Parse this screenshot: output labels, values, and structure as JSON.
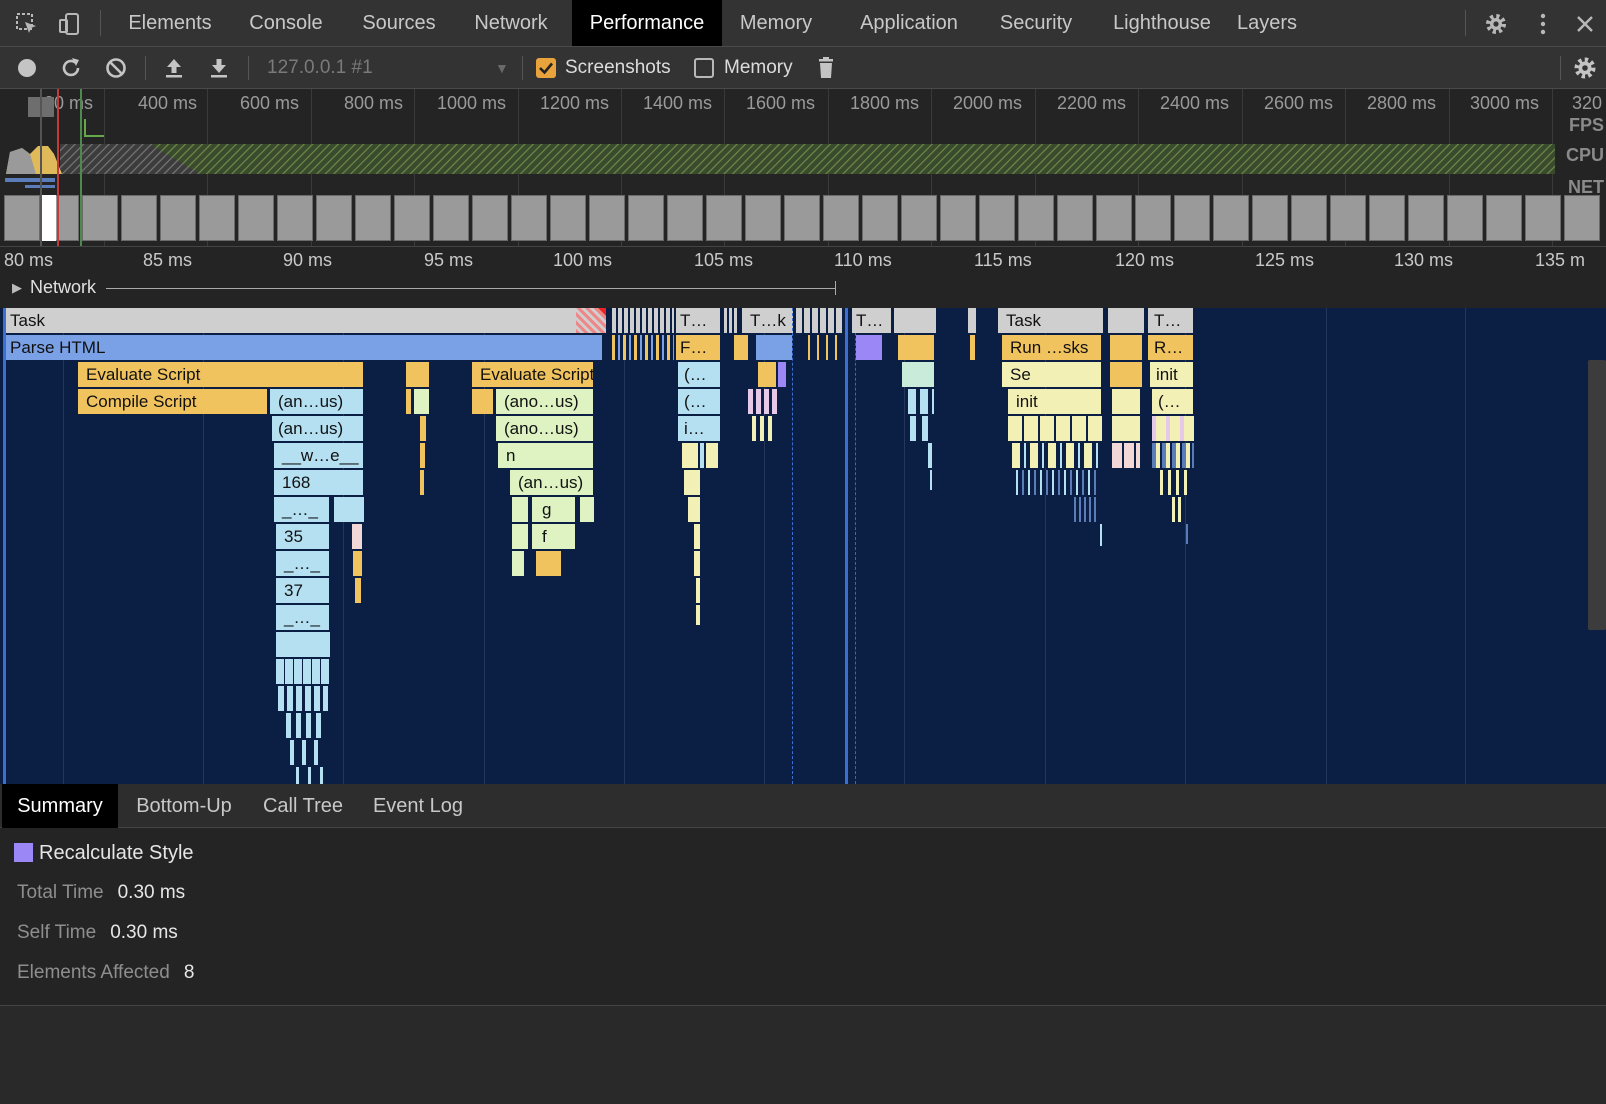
{
  "tabs": [
    "Elements",
    "Console",
    "Sources",
    "Network",
    "Performance",
    "Memory",
    "Application",
    "Security",
    "Lighthouse",
    "Layers"
  ],
  "active_tab": "Performance",
  "toolbar": {
    "target": "127.0.0.1 #1",
    "screenshots_label": "Screenshots",
    "screenshots_checked": true,
    "memory_label": "Memory",
    "memory_checked": false
  },
  "overview": {
    "labels": [
      "00 ms",
      "400 ms",
      "600 ms",
      "800 ms",
      "1000 ms",
      "1200 ms",
      "1400 ms",
      "1600 ms",
      "1800 ms",
      "2000 ms",
      "2200 ms",
      "2400 ms",
      "2600 ms",
      "2800 ms",
      "3000 ms",
      "320"
    ],
    "fps": "FPS",
    "cpu": "CPU",
    "net": "NET"
  },
  "ruler": [
    "80 ms",
    "85 ms",
    "90 ms",
    "95 ms",
    "100 ms",
    "105 ms",
    "110 ms",
    "115 ms",
    "120 ms",
    "125 ms",
    "130 ms",
    "135 m"
  ],
  "network_label": "Network",
  "flame": {
    "task": "Task",
    "parse_html": "Parse HTML",
    "evaluate_script": "Evaluate Script",
    "compile_script": "Compile Script",
    "an_us_1": "(an…us)",
    "an_us_2": "(an…us)",
    "w_e": "__w…e__",
    "n168": "168",
    "dots1": "_…_",
    "n35": "35",
    "dots2": "_…_",
    "n37": "37",
    "dots3": "_…_",
    "evalu_cript": "Evalu…cript",
    "ano_us_1": "(ano…us)",
    "ano_us_2": "(ano…us)",
    "n": "n",
    "an_us_3": "(an…us)",
    "g": "g",
    "f": "f",
    "t_1": "T…",
    "f_dots": "F…",
    "paren_1": "(…",
    "paren_2": "(…",
    "i_dots": "i…",
    "t_k": "T…k",
    "t_2": "T…",
    "task2": "Task",
    "run_sks": "Run …sks",
    "se": "Se",
    "init_1": "init",
    "t_3": "T…",
    "r_dots": "R…",
    "init_2": "init",
    "paren_3": "(…"
  },
  "bottom_tabs": [
    "Summary",
    "Bottom-Up",
    "Call Tree",
    "Event Log"
  ],
  "active_bottom_tab": "Summary",
  "summary": {
    "title": "Recalculate Style",
    "color": "#9b87f5",
    "total_time_label": "Total Time",
    "total_time": "0.30 ms",
    "self_time_label": "Self Time",
    "self_time": "0.30 ms",
    "elements_affected_label": "Elements Affected",
    "elements_affected": "8"
  },
  "colors": {
    "task": "#cfcfcf",
    "parse_html": "#7aa1e6",
    "script": "#f0c35e",
    "js_frame": "#b4e0f2",
    "js_frame_green": "#dff3c2",
    "js_frame_yellow": "#f3f0b6",
    "flame_bg": "#0b1f45"
  }
}
